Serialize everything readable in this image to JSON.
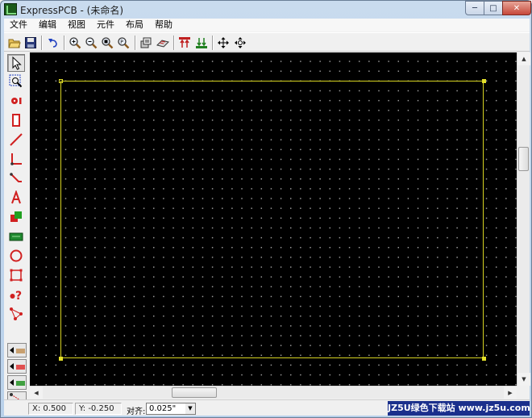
{
  "window": {
    "title": "ExpressPCB - (未命名)",
    "minimize_glyph": "─",
    "maximize_glyph": "□",
    "close_glyph": "✕"
  },
  "menu": [
    {
      "label": "文件"
    },
    {
      "label": "编辑"
    },
    {
      "label": "视图"
    },
    {
      "label": "元件"
    },
    {
      "label": "布局"
    },
    {
      "label": "帮助"
    }
  ],
  "toolbar": [
    {
      "name": "open-folder-icon"
    },
    {
      "name": "save-icon"
    },
    {
      "name": "undo-icon"
    },
    {
      "name": "zoom-in-icon"
    },
    {
      "name": "zoom-out-icon"
    },
    {
      "name": "zoom-page-icon"
    },
    {
      "name": "zoom-board-icon"
    },
    {
      "name": "component-manager-icon"
    },
    {
      "name": "layer-view-icon"
    },
    {
      "name": "top-layer-icon"
    },
    {
      "name": "bottom-layer-icon"
    },
    {
      "name": "move-icon"
    },
    {
      "name": "rotate-move-icon"
    }
  ],
  "palette": [
    {
      "name": "select-arrow-icon"
    },
    {
      "name": "zoom-area-icon"
    },
    {
      "name": "place-pad-icon"
    },
    {
      "name": "place-component-icon"
    },
    {
      "name": "place-trace-icon"
    },
    {
      "name": "place-corner-trace-icon"
    },
    {
      "name": "place-angled-trace-icon"
    },
    {
      "name": "place-text-icon"
    },
    {
      "name": "place-shape-icon"
    },
    {
      "name": "filled-plane-icon"
    },
    {
      "name": "place-circle-icon"
    },
    {
      "name": "board-outline-icon"
    },
    {
      "name": "query-icon"
    },
    {
      "name": "netlist-icon"
    }
  ],
  "layer_buttons": [
    {
      "name": "layer-top-copper-button",
      "color": "#c8a070"
    },
    {
      "name": "layer-top-silk-button",
      "color": "#e05050"
    },
    {
      "name": "layer-bottom-copper-button",
      "color": "#40a040"
    },
    {
      "name": "layer-ratsnest-button",
      "color": "#d02020"
    }
  ],
  "colors": {
    "canvas_background": "#000000",
    "board_outline": "#d7d321",
    "grid_dot": "#9a9a9a",
    "watermark_bg": "#1a2f8c"
  },
  "status": {
    "x_coord": "X: 0.500",
    "y_coord": "Y: -0.250",
    "snap_label": "对齐:",
    "snap_value": "0.025\""
  },
  "watermark": "JZ5U绿色下载站 www.jz5u.com"
}
